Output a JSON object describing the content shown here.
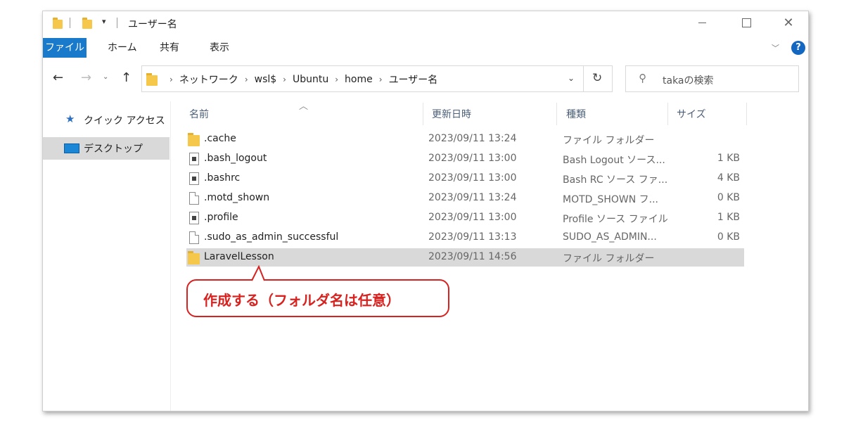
{
  "window": {
    "title": "ユーザー名",
    "qa_dropdown_glyph": "▾"
  },
  "ribbon": {
    "tabs": [
      "ファイル",
      "ホーム",
      "共有",
      "表示"
    ],
    "help_label": "?"
  },
  "address": {
    "crumbs": [
      "ネットワーク",
      "wsl$",
      "Ubuntu",
      "home",
      "ユーザー名"
    ],
    "separator": "›",
    "search_placeholder": "takaの検索"
  },
  "nav_pane": {
    "quick_access": "クイック アクセス",
    "desktop": "デスクトップ"
  },
  "file_list": {
    "columns": {
      "name": "名前",
      "date": "更新日時",
      "type": "種類",
      "size": "サイズ"
    },
    "rows": [
      {
        "name": ".cache",
        "date": "2023/09/11 13:24",
        "type": "ファイル フォルダー",
        "size": "",
        "icon": "folder-icon"
      },
      {
        "name": ".bash_logout",
        "date": "2023/09/11 13:00",
        "type": "Bash Logout ソース...",
        "size": "1 KB",
        "icon": "source-file-icon"
      },
      {
        "name": ".bashrc",
        "date": "2023/09/11 13:00",
        "type": "Bash RC ソース ファ...",
        "size": "4 KB",
        "icon": "source-file-icon"
      },
      {
        "name": ".motd_shown",
        "date": "2023/09/11 13:24",
        "type": "MOTD_SHOWN フ...",
        "size": "0 KB",
        "icon": "blank-file-icon"
      },
      {
        "name": ".profile",
        "date": "2023/09/11 13:00",
        "type": "Profile ソース ファイル",
        "size": "1 KB",
        "icon": "source-file-icon"
      },
      {
        "name": ".sudo_as_admin_successful",
        "date": "2023/09/11 13:13",
        "type": "SUDO_AS_ADMIN...",
        "size": "0 KB",
        "icon": "blank-file-icon"
      },
      {
        "name": "LaravelLesson",
        "date": "2023/09/11 14:56",
        "type": "ファイル フォルダー",
        "size": "",
        "icon": "folder-icon",
        "selected": true
      }
    ]
  },
  "annotation": {
    "text": "作成する（フォルダ名は任意）",
    "color": "#d8221f"
  },
  "colors": {
    "file_tab": "#1979ca",
    "selected_row": "#d9d9d9",
    "folder": "#f5c74a"
  }
}
